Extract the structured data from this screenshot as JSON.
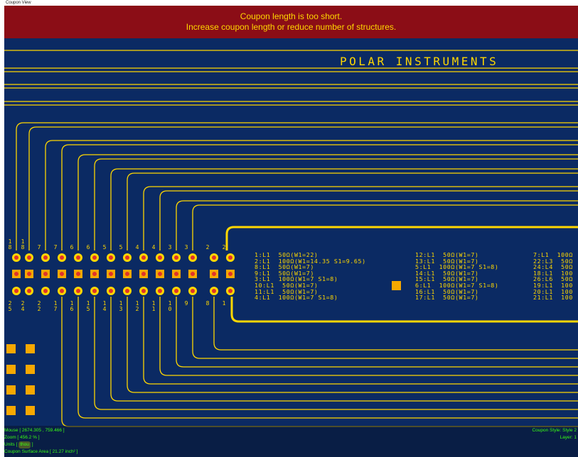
{
  "window": {
    "title": "Coupon View"
  },
  "warning": {
    "line1": "Coupon length is too short.",
    "line2": "Increase coupon length or reduce number of structures."
  },
  "brand": "POLAR INSTRUMENTS",
  "pad_labels_top": [
    "1\n8",
    "1\n8",
    "7",
    "7",
    "6",
    "6",
    "5",
    "5",
    "4",
    "4",
    "3",
    "3",
    "2",
    "2"
  ],
  "pad_labels_bottom": [
    "2\n5",
    "2\n4",
    "2\n2",
    "1\n7",
    "1\n6",
    "1\n5",
    "1\n4",
    "1\n3",
    "1\n2",
    "1\n1",
    "1\n0",
    "9",
    "8",
    "1"
  ],
  "structures": {
    "col1": [
      "1:L1  50Ω(W1=22)",
      "2:L1  100Ω(W1=14.35 S1=9.65)",
      "8:L1  50Ω(W1=7)",
      "9:L1  50Ω(W1=7)",
      "3:L1  100Ω(W1=7 S1=8)",
      "10:L1  50Ω(W1=7)",
      "11:L1  50Ω(W1=7)",
      "4:L1  100Ω(W1=7 S1=8)"
    ],
    "col2": [
      "12:L1  50Ω(W1=7)",
      "13:L1  50Ω(W1=7)",
      "5:L1  100Ω(W1=7 S1=8)",
      "14:L1  50Ω(W1=7)",
      "15:L1  50Ω(W1=7)",
      "6:L1  100Ω(W1=7 S1=8)",
      "16:L1  50Ω(W1=7)",
      "17:L1  50Ω(W1=7)"
    ],
    "col3": [
      "7:L1  100Ω",
      "22:L3  50Ω",
      "24:L4  50Ω",
      "18:L1  100",
      "26:L6  50Ω",
      "19:L1  100",
      "20:L1  100",
      "21:L1  100"
    ]
  },
  "status": {
    "mouse": "Mouse [ 2674.305 , 759.466 ]",
    "zoom": "Zoom [ 456.2 % ]",
    "units_label": "Units [",
    "units_value": "thou",
    "units_close": "]",
    "area": "Coupon Surface Area [ 21.27 inch² ]",
    "coupon_style": "Coupon Style: Style 2",
    "layer": "Layer: 1"
  },
  "colors": {
    "board": "#0b2a63",
    "trace": "#ffd700",
    "pad_ring": "#ffd700",
    "pad_center": "#e0322a",
    "square_pad": "#f7a800",
    "warning_bg": "#8b0d16",
    "status_text": "#39ff14"
  }
}
